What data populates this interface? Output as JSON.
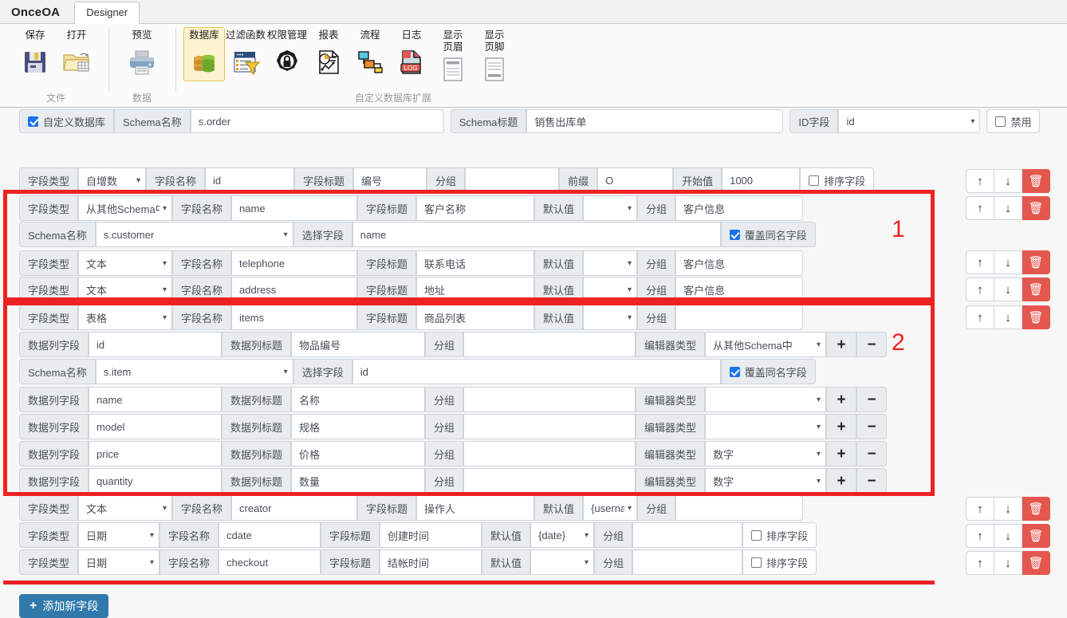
{
  "titlebar": {
    "brand": "OnceOA",
    "tabs": [
      {
        "label": "Designer",
        "active": true
      }
    ]
  },
  "ribbon": {
    "groups": [
      {
        "title": "文件",
        "items": [
          {
            "label": "保存",
            "icon": "save-icon"
          },
          {
            "label": "打开",
            "icon": "open-folder-icon"
          }
        ]
      },
      {
        "title": "数据",
        "items": [
          {
            "label": "预览",
            "icon": "printer-icon"
          }
        ]
      },
      {
        "title": "自定义数据库扩展",
        "items": [
          {
            "label": "数据库",
            "icon": "database-icon",
            "selected": true
          },
          {
            "label": "过滤函数",
            "icon": "filter-icon"
          },
          {
            "label": "权限管理",
            "icon": "lock-icon"
          },
          {
            "label": "报表",
            "icon": "report-icon"
          },
          {
            "label": "流程",
            "icon": "workflow-icon"
          },
          {
            "label": "日志",
            "icon": "log-icon"
          },
          {
            "label": "显示\n页眉",
            "icon": "header-icon"
          },
          {
            "label": "显示\n页脚",
            "icon": "footer-icon"
          }
        ]
      }
    ]
  },
  "schemabar": {
    "custom_db_label": "自定义数据库",
    "custom_db_checked": true,
    "schema_name_label": "Schema名称",
    "schema_name_value": "s.order",
    "schema_title_label": "Schema标题",
    "schema_title_value": "销售出库单",
    "id_field_label": "ID字段",
    "id_field_value": "id",
    "disable_label": "禁用",
    "disable_checked": false
  },
  "labels": {
    "field_type": "字段类型",
    "field_name": "字段名称",
    "field_title": "字段标题",
    "group": "分组",
    "prefix": "前缀",
    "start_value": "开始值",
    "sort_field": "排序字段",
    "default_value": "默认值",
    "schema_name": "Schema名称",
    "select_field": "选择字段",
    "override_same_name": "覆盖同名字段",
    "data_col_field": "数据列字段",
    "data_col_title": "数据列标题",
    "editor_type": "编辑器类型"
  },
  "icons": {
    "up": "↑",
    "down": "↓",
    "trash": "🗑",
    "plus": "+",
    "minus": "−",
    "caret": "⌄"
  },
  "rows": [
    {
      "kind": "field",
      "type": "自增数",
      "name": "id",
      "title": "编号",
      "group": "",
      "prefix_label": "前缀",
      "prefix": "O",
      "start_label": "开始值",
      "start": "1000",
      "sort_label": "排序字段",
      "sort_checked": false
    },
    {
      "kind": "field_default",
      "type": "从其他Schema中",
      "name": "name",
      "title": "客户名称",
      "default": "",
      "group": "客户信息"
    },
    {
      "kind": "schema_ref",
      "schema": "s.customer",
      "field": "name",
      "override": true
    },
    {
      "kind": "field_default",
      "type": "文本",
      "name": "telephone",
      "title": "联系电话",
      "default": "",
      "group": "客户信息"
    },
    {
      "kind": "field_default",
      "type": "文本",
      "name": "address",
      "title": "地址",
      "default": "",
      "group": "客户信息"
    },
    {
      "kind": "field_default",
      "type": "表格",
      "name": "items",
      "title": "商品列表",
      "default": "",
      "group": ""
    },
    {
      "kind": "data_col",
      "field": "id",
      "title": "物品编号",
      "group": "",
      "editor": "从其他Schema中"
    },
    {
      "kind": "schema_ref",
      "schema": "s.item",
      "field": "id",
      "override": true
    },
    {
      "kind": "data_col",
      "field": "name",
      "title": "名称",
      "group": "",
      "editor": ""
    },
    {
      "kind": "data_col",
      "field": "model",
      "title": "规格",
      "group": "",
      "editor": ""
    },
    {
      "kind": "data_col",
      "field": "price",
      "title": "价格",
      "group": "",
      "editor": "数字"
    },
    {
      "kind": "data_col",
      "field": "quantity",
      "title": "数量",
      "group": "",
      "editor": "数字"
    },
    {
      "kind": "field_default",
      "type": "文本",
      "name": "creator",
      "title": "操作人",
      "default": "{username}",
      "group": ""
    },
    {
      "kind": "field_sort",
      "type": "日期",
      "name": "cdate",
      "title": "创建时间",
      "default": "{date}",
      "group": "",
      "sort_label": "排序字段",
      "sort_checked": false
    },
    {
      "kind": "field_sort",
      "type": "日期",
      "name": "checkout",
      "title": "结帐时间",
      "default": "",
      "group": "",
      "sort_label": "排序字段",
      "sort_checked": false
    }
  ],
  "annotations": [
    {
      "number": "1"
    },
    {
      "number": "2"
    }
  ],
  "footer": {
    "add_field_label": "添加新字段",
    "add_field_plus": "+"
  },
  "colors": {
    "accent_red": "#ee2222",
    "delete_red": "#e4574f",
    "primary_blue": "#3179ab",
    "checkbox_blue": "#1a73e8",
    "ribbon_selected": "#fdf3cf"
  }
}
